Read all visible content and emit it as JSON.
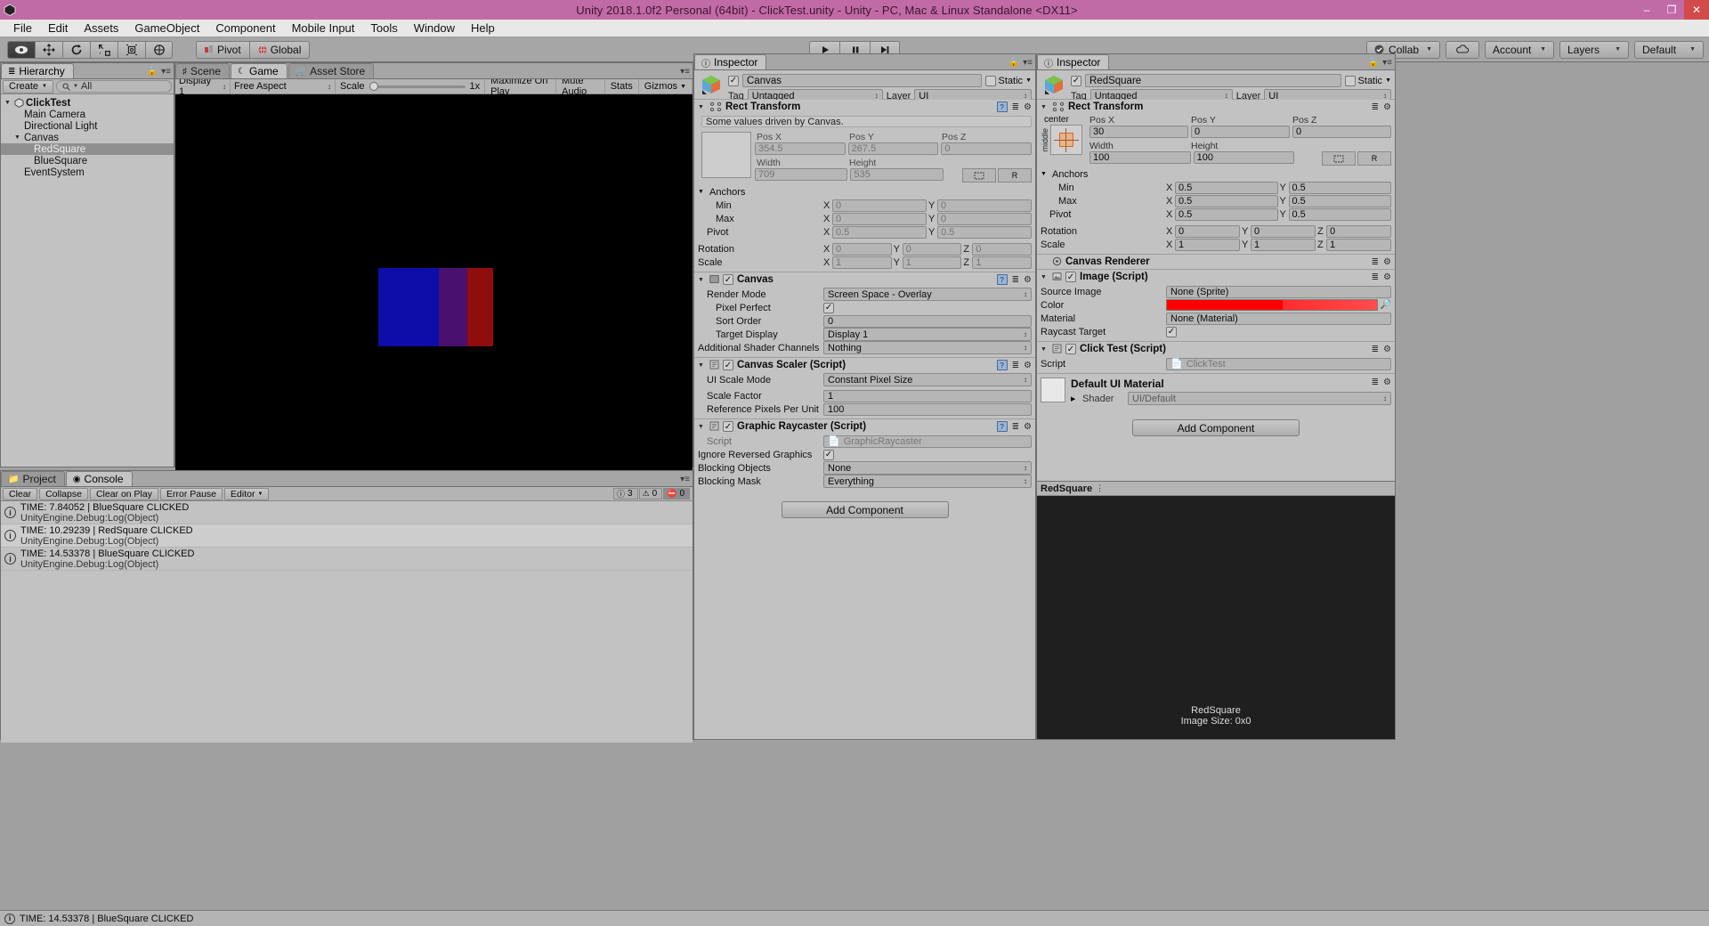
{
  "window": {
    "title": "Unity 2018.1.0f2 Personal (64bit) - ClickTest.unity - Unity - PC, Mac & Linux Standalone <DX11>",
    "minimize": "–",
    "maximize": "❐",
    "close": "✕"
  },
  "menu": {
    "items": [
      "File",
      "Edit",
      "Assets",
      "GameObject",
      "Component",
      "Mobile Input",
      "Tools",
      "Window",
      "Help"
    ]
  },
  "toolbar": {
    "transform_tools": [
      "hand-tool",
      "move-tool",
      "rotate-tool",
      "scale-tool",
      "rect-tool",
      "transform-tool"
    ],
    "pivot_label": "Pivot",
    "global_label": "Global",
    "play": "▶",
    "pause": "❙❙",
    "step": "▶❘",
    "collab_label": "Collab",
    "cloud_label": "cloud-icon",
    "account_label": "Account",
    "layers_label": "Layers",
    "layout_label": "Default"
  },
  "hierarchy": {
    "tab_label": "Hierarchy",
    "create_label": "Create",
    "search_placeholder": "All",
    "search_value": "All",
    "items": [
      {
        "label": "ClickTest",
        "depth": 0,
        "expanded": true,
        "selected": false,
        "scene": true
      },
      {
        "label": "Main Camera",
        "depth": 1,
        "expanded": null,
        "selected": false,
        "scene": false
      },
      {
        "label": "Directional Light",
        "depth": 1,
        "expanded": null,
        "selected": false,
        "scene": false
      },
      {
        "label": "Canvas",
        "depth": 1,
        "expanded": true,
        "selected": false,
        "scene": false
      },
      {
        "label": "RedSquare",
        "depth": 2,
        "expanded": null,
        "selected": true,
        "scene": false
      },
      {
        "label": "BlueSquare",
        "depth": 2,
        "expanded": null,
        "selected": false,
        "scene": false
      },
      {
        "label": "EventSystem",
        "depth": 1,
        "expanded": null,
        "selected": false,
        "scene": false
      }
    ]
  },
  "gameview": {
    "tabs": [
      {
        "label": "Scene",
        "icon": "scene-icon",
        "active": false
      },
      {
        "label": "Game",
        "icon": "game-icon",
        "active": true
      },
      {
        "label": "Asset Store",
        "icon": "store-icon",
        "active": false
      }
    ],
    "display": "Display 1",
    "aspect": "Free Aspect",
    "scale_label": "Scale",
    "scale_value": "1x",
    "maximize_on_play": "Maximize On Play",
    "mute_audio": "Mute Audio",
    "stats": "Stats",
    "gizmos": "Gizmos",
    "squares": [
      {
        "name": "blue-square",
        "color": "#0d0da8"
      },
      {
        "name": "overlap-square",
        "color": "#4a1070"
      },
      {
        "name": "red-square",
        "color": "#8f0d0d"
      }
    ]
  },
  "console": {
    "tabs": [
      {
        "label": "Project",
        "icon": "project-icon",
        "active": false
      },
      {
        "label": "Console",
        "icon": "console-icon",
        "active": true
      }
    ],
    "buttons": [
      "Clear",
      "Collapse",
      "Clear on Play",
      "Error Pause",
      "Editor"
    ],
    "counts": {
      "info": "3",
      "warning": "0",
      "error": "0"
    },
    "logs": [
      {
        "line1": "TIME: 7.84052 | BlueSquare CLICKED",
        "line2": "UnityEngine.Debug:Log(Object)",
        "type": "info"
      },
      {
        "line1": "TIME: 10.29239 | RedSquare CLICKED",
        "line2": "UnityEngine.Debug:Log(Object)",
        "type": "info"
      },
      {
        "line1": "TIME: 14.53378 | BlueSquare CLICKED",
        "line2": "UnityEngine.Debug:Log(Object)",
        "type": "info"
      }
    ]
  },
  "inspector_mid": {
    "tab_label": "Inspector",
    "object_name": "Canvas",
    "enabled": true,
    "static_label": "Static",
    "tag_label": "Tag",
    "tag_value": "Untagged",
    "layer_label": "Layer",
    "layer_value": "UI",
    "rect_transform": {
      "title": "Rect Transform",
      "note": "Some values driven by Canvas.",
      "pos_x_label": "Pos X",
      "pos_y_label": "Pos Y",
      "pos_z_label": "Pos Z",
      "pos_x": "354.5",
      "pos_y": "267.5",
      "pos_z": "0",
      "width_label": "Width",
      "height_label": "Height",
      "width": "709",
      "height": "535",
      "anchors_label": "Anchors",
      "min_label": "Min",
      "min_x": "0",
      "min_y": "0",
      "max_label": "Max",
      "max_x": "0",
      "max_y": "0",
      "pivot_label": "Pivot",
      "pivot_x": "0.5",
      "pivot_y": "0.5",
      "rotation_label": "Rotation",
      "rot_x": "0",
      "rot_y": "0",
      "rot_z": "0",
      "scale_label": "Scale",
      "scale_x": "1",
      "scale_y": "1",
      "scale_z": "1",
      "blueprint_label": "R"
    },
    "canvas": {
      "title": "Canvas",
      "enabled": true,
      "render_mode_label": "Render Mode",
      "render_mode_value": "Screen Space - Overlay",
      "pixel_perfect_label": "Pixel Perfect",
      "pixel_perfect": true,
      "sort_order_label": "Sort Order",
      "sort_order_value": "0",
      "target_display_label": "Target Display",
      "target_display_value": "Display 1",
      "shader_channels_label": "Additional Shader Channels",
      "shader_channels_value": "Nothing"
    },
    "canvas_scaler": {
      "title": "Canvas Scaler (Script)",
      "enabled": true,
      "ui_scale_mode_label": "UI Scale Mode",
      "ui_scale_mode_value": "Constant Pixel Size",
      "scale_factor_label": "Scale Factor",
      "scale_factor_value": "1",
      "ref_px_label": "Reference Pixels Per Unit",
      "ref_px_value": "100"
    },
    "graphic_raycaster": {
      "title": "Graphic Raycaster (Script)",
      "enabled": true,
      "script_label": "Script",
      "script_value": "GraphicRaycaster",
      "ignore_reversed_label": "Ignore Reversed Graphics",
      "ignore_reversed": true,
      "blocking_objects_label": "Blocking Objects",
      "blocking_objects_value": "None",
      "blocking_mask_label": "Blocking Mask",
      "blocking_mask_value": "Everything"
    },
    "add_component": "Add Component"
  },
  "inspector_right": {
    "tab_label": "Inspector",
    "object_name": "RedSquare",
    "enabled": true,
    "static_label": "Static",
    "tag_label": "Tag",
    "tag_value": "Untagged",
    "layer_label": "Layer",
    "layer_value": "UI",
    "rect_transform": {
      "title": "Rect Transform",
      "anchor_preset": "center",
      "anchor_preset_side": "middle",
      "pos_x_label": "Pos X",
      "pos_y_label": "Pos Y",
      "pos_z_label": "Pos Z",
      "pos_x": "30",
      "pos_y": "0",
      "pos_z": "0",
      "width_label": "Width",
      "height_label": "Height",
      "width": "100",
      "height": "100",
      "anchors_label": "Anchors",
      "min_label": "Min",
      "min_x": "0.5",
      "min_y": "0.5",
      "max_label": "Max",
      "max_x": "0.5",
      "max_y": "0.5",
      "pivot_label": "Pivot",
      "pivot_x": "0.5",
      "pivot_y": "0.5",
      "rotation_label": "Rotation",
      "rot_x": "0",
      "rot_y": "0",
      "rot_z": "0",
      "scale_label": "Scale",
      "scale_x": "1",
      "scale_y": "1",
      "scale_z": "1",
      "blueprint_label": "R"
    },
    "canvas_renderer": {
      "title": "Canvas Renderer"
    },
    "image": {
      "title": "Image (Script)",
      "enabled": true,
      "source_image_label": "Source Image",
      "source_image_value": "None (Sprite)",
      "color_label": "Color",
      "color_value": "#FF0000",
      "material_label": "Material",
      "material_value": "None (Material)",
      "raycast_label": "Raycast Target",
      "raycast_target": true
    },
    "click_test": {
      "title": "Click Test (Script)",
      "enabled": true,
      "script_label": "Script",
      "script_value": "ClickTest"
    },
    "material": {
      "name": "Default UI Material",
      "shader_label": "Shader",
      "shader_value": "UI/Default"
    },
    "add_component": "Add Component",
    "preview": {
      "title": "RedSquare",
      "line1": "RedSquare",
      "line2": "Image Size: 0x0"
    }
  },
  "statusbar": {
    "message": "TIME: 14.53378 | BlueSquare CLICKED"
  }
}
